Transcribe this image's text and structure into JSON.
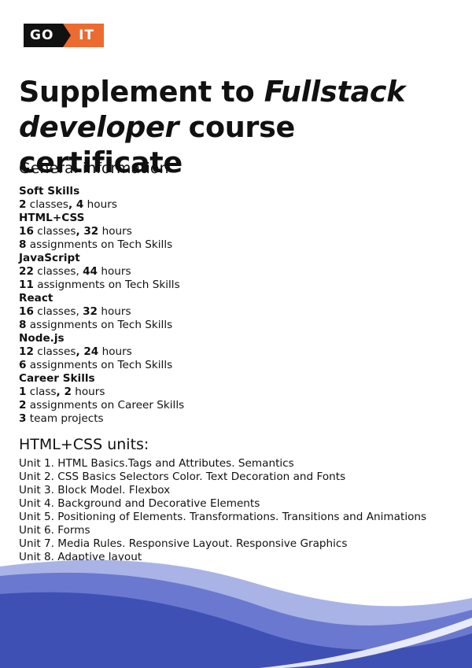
{
  "logo": {
    "left": "GO",
    "right": "IT"
  },
  "title": {
    "prefix": "Supplement to ",
    "italic_1": "Fullstack",
    "italic_2": "developer",
    "suffix": " course certificate"
  },
  "general": {
    "heading": "General information",
    "courses": [
      {
        "name": "Soft Skills",
        "classes_num": "2",
        "classes_word": " classes",
        "hours_num": "4",
        "hours_word": " hours"
      },
      {
        "name": "HTML+CSS",
        "classes_num": "16",
        "classes_word": " classes",
        "hours_num": "32",
        "hours_word": " hours",
        "assign_num": "8",
        "assign_text": " assignments on Tech Skills"
      },
      {
        "name": "JavaScript",
        "classes_num": "22",
        "classes_word": " classes",
        "hours_num": "44",
        "hours_word": " hours",
        "assign_num": "11",
        "assign_text": " assignments on Tech Skills"
      },
      {
        "name": "React",
        "classes_num": "16",
        "classes_word": " classes",
        "hours_num": "32",
        "hours_word": " hours",
        "assign_num": "8",
        "assign_text": " assignments on Tech Skills"
      },
      {
        "name": "Node.js",
        "classes_num": "12",
        "classes_word": " classes",
        "hours_num": "24",
        "hours_word": " hours",
        "assign_num": "6",
        "assign_text": " assignments on Tech Skills"
      },
      {
        "name": "Career Skills",
        "classes_num": "1",
        "classes_word": " class",
        "hours_num": "2",
        "hours_word": " hours",
        "assign_num": "2",
        "assign_text": " assignments on Career Skills"
      }
    ],
    "team": {
      "num": "3",
      "text": " team projects"
    }
  },
  "units": {
    "heading": "HTML+CSS units:",
    "items": [
      "Unit 1. HTML Basics.Tags and Attributes. Semantics",
      "Unit 2. CSS Basics Selectors Color. Text Decoration and Fonts",
      "Unit 3. Block Model. Flexbox",
      "Unit 4. Background and Decorative Elements",
      "Unit 5. Positioning of Elements. Transformations. Transitions and Animations",
      "Unit 6. Forms",
      "Unit 7. Media Rules. Responsive Layout. Responsive Graphics",
      "Unit 8. Adaptive layout"
    ]
  },
  "colors": {
    "logo_black": "#111111",
    "logo_orange": "#ec6b30",
    "wave_dark": "#3e4fb8",
    "wave_mid": "#5b6bc8",
    "wave_light": "#9aa6e0"
  }
}
